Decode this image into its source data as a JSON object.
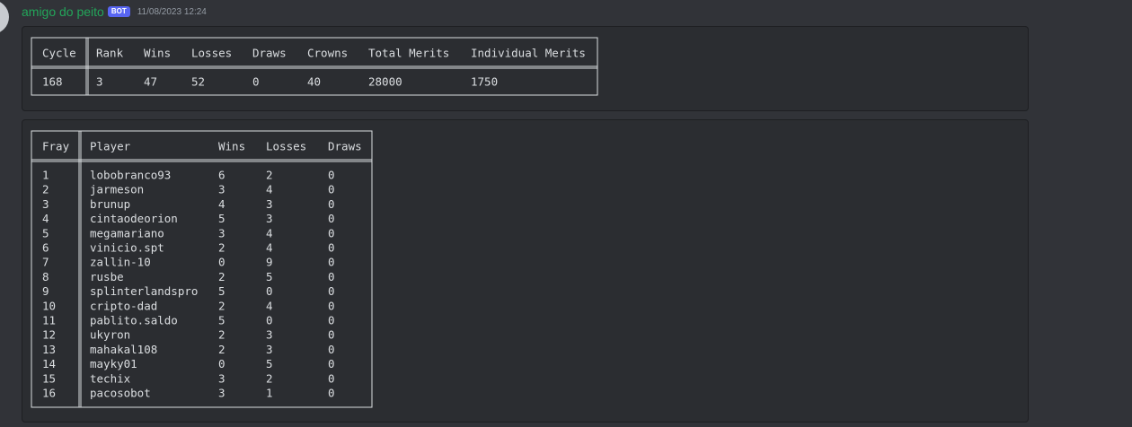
{
  "message": {
    "username": "amigo do peito",
    "badge": "BOT",
    "timestamp": "11/08/2023 12:24"
  },
  "table1": {
    "headers": [
      "Cycle",
      "Rank",
      "Wins",
      "Losses",
      "Draws",
      "Crowns",
      "Total Merits",
      "Individual Merits"
    ],
    "rows": [
      [
        "168",
        "3",
        "47",
        "52",
        "0",
        "40",
        "28000",
        "1750"
      ]
    ]
  },
  "table2": {
    "headers": [
      "Fray",
      "Player",
      "Wins",
      "Losses",
      "Draws"
    ],
    "rows": [
      [
        "1",
        "lobobranco93",
        "6",
        "2",
        "0"
      ],
      [
        "2",
        "jarmeson",
        "3",
        "4",
        "0"
      ],
      [
        "3",
        "brunup",
        "4",
        "3",
        "0"
      ],
      [
        "4",
        "cintaodeorion",
        "5",
        "3",
        "0"
      ],
      [
        "5",
        "megamariano",
        "3",
        "4",
        "0"
      ],
      [
        "6",
        "vinicio.spt",
        "2",
        "4",
        "0"
      ],
      [
        "7",
        "zallin-10",
        "0",
        "9",
        "0"
      ],
      [
        "8",
        "rusbe",
        "2",
        "5",
        "0"
      ],
      [
        "9",
        "splinterlandspro",
        "5",
        "0",
        "0"
      ],
      [
        "10",
        "cripto-dad",
        "2",
        "4",
        "0"
      ],
      [
        "11",
        "pablito.saldo",
        "5",
        "0",
        "0"
      ],
      [
        "12",
        "ukyron",
        "2",
        "3",
        "0"
      ],
      [
        "13",
        "mahakal108",
        "2",
        "3",
        "0"
      ],
      [
        "14",
        "mayky01",
        "0",
        "5",
        "0"
      ],
      [
        "15",
        "techix",
        "3",
        "2",
        "0"
      ],
      [
        "16",
        "pacosobot",
        "3",
        "1",
        "0"
      ]
    ]
  }
}
